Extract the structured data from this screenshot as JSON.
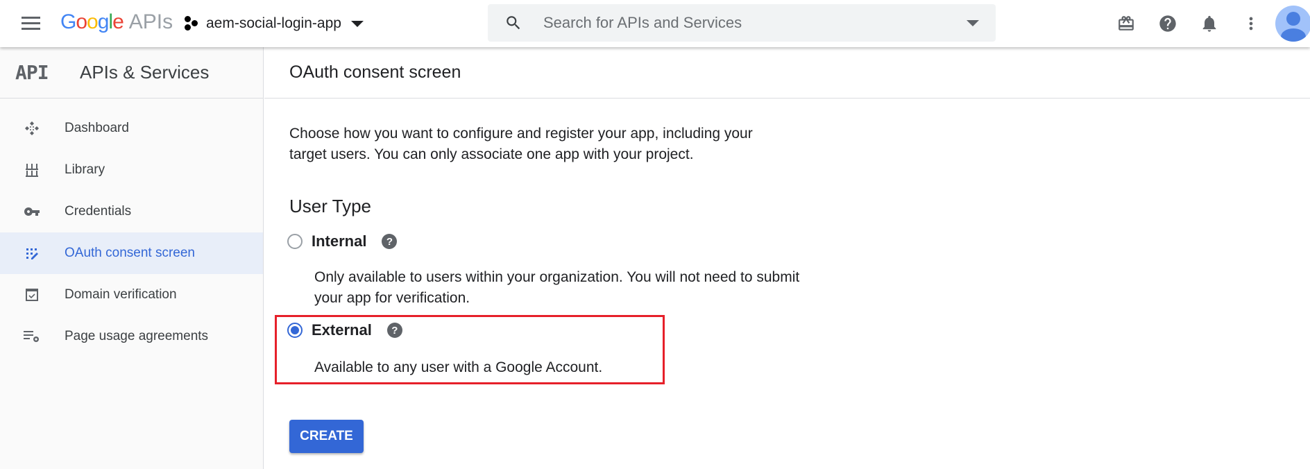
{
  "header": {
    "logo_google": [
      "G",
      "o",
      "o",
      "g",
      "l",
      "e"
    ],
    "logo_suffix": "APIs",
    "project_name": "aem-social-login-app",
    "search": {
      "placeholder": "Search for APIs and Services",
      "value": ""
    },
    "icons": [
      "gift-icon",
      "help-icon",
      "notifications-icon",
      "more-vert-icon",
      "account-avatar"
    ]
  },
  "sidebar": {
    "logo": "API",
    "title": "APIs & Services",
    "items": [
      {
        "label": "Dashboard",
        "icon": "dashboard-icon",
        "active": false
      },
      {
        "label": "Library",
        "icon": "library-icon",
        "active": false
      },
      {
        "label": "Credentials",
        "icon": "key-icon",
        "active": false
      },
      {
        "label": "OAuth consent screen",
        "icon": "oauth-consent-icon",
        "active": true
      },
      {
        "label": "Domain verification",
        "icon": "checkbox-icon",
        "active": false
      },
      {
        "label": "Page usage agreements",
        "icon": "settings-list-icon",
        "active": false
      }
    ]
  },
  "main": {
    "title": "OAuth consent screen",
    "intro": "Choose how you want to configure and register your app, including your target users. You can only associate one app with your project.",
    "user_type": {
      "heading": "User Type",
      "options": [
        {
          "label": "Internal",
          "selected": false,
          "description": "Only available to users within your organization. You will not need to submit your app for verification.",
          "help": "?"
        },
        {
          "label": "External",
          "selected": true,
          "description": "Available to any user with a Google Account.",
          "help": "?"
        }
      ]
    },
    "create_label": "CREATE"
  },
  "colors": {
    "accent": "#3367d6",
    "highlight_border": "#e6202a",
    "active_item_bg": "#e8eef9"
  }
}
